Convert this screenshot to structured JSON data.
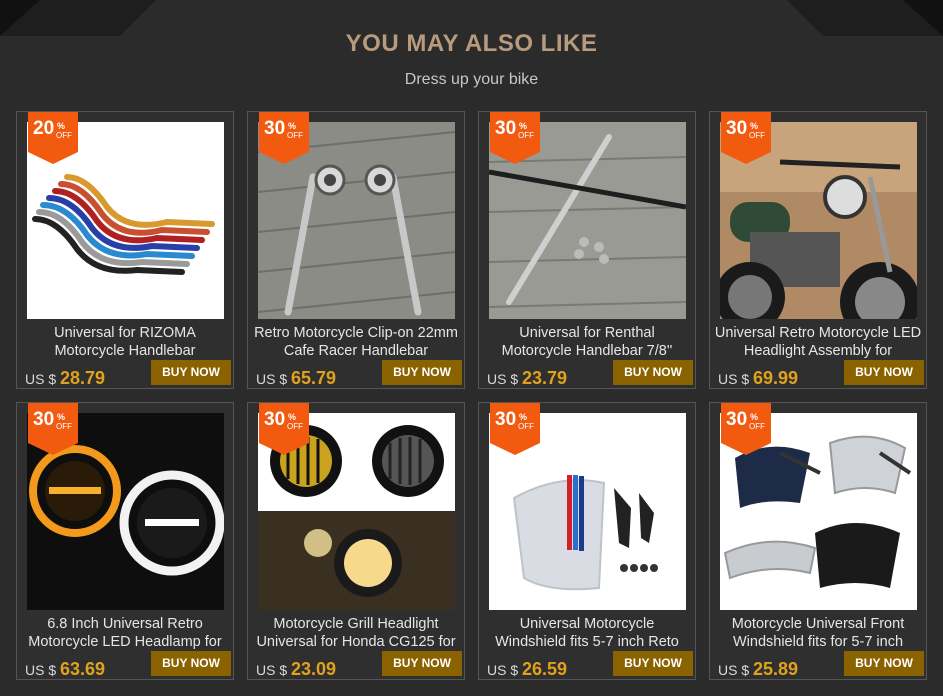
{
  "section": {
    "heading": "YOU MAY ALSO LIKE",
    "subheading": "Dress up your bike"
  },
  "colors": {
    "badge": "#f25a0f",
    "price": "#e0a11c",
    "button": "#8a6200",
    "heading": "#b89b7c"
  },
  "products": [
    {
      "discount": "20",
      "pct": "%",
      "off": "OFF",
      "title": "Universal for RIZOMA Motorcycle Handlebar",
      "currency": "US $",
      "price": "28.79",
      "button": "BUY NOW",
      "image": "handlebars-set"
    },
    {
      "discount": "30",
      "pct": "%",
      "off": "OFF",
      "title": "Retro Motorcycle Clip-on 22mm Cafe Racer Handlebar",
      "currency": "US $",
      "price": "65.79",
      "button": "BUY NOW",
      "image": "clip-on-handlebar"
    },
    {
      "discount": "30",
      "pct": "%",
      "off": "OFF",
      "title": "Universal for Renthal Motorcycle Handlebar 7/8''",
      "currency": "US $",
      "price": "23.79",
      "button": "BUY NOW",
      "image": "straight-handlebar"
    },
    {
      "discount": "30",
      "pct": "%",
      "off": "OFF",
      "title": "Universal Retro Motorcycle LED Headlight Assembly for",
      "currency": "US $",
      "price": "69.99",
      "button": "BUY NOW",
      "image": "motorcycle-photo"
    },
    {
      "discount": "30",
      "pct": "%",
      "off": "OFF",
      "title": "6.8 Inch Universal Retro Motorcycle LED Headlamp for",
      "currency": "US $",
      "price": "63.69",
      "button": "BUY NOW",
      "image": "led-headlamps"
    },
    {
      "discount": "30",
      "pct": "%",
      "off": "OFF",
      "title": "Motorcycle Grill Headlight Universal for Honda CG125 for",
      "currency": "US $",
      "price": "23.09",
      "button": "BUY NOW",
      "image": "grill-headlights"
    },
    {
      "discount": "30",
      "pct": "%",
      "off": "OFF",
      "title": "Universal Motorcycle Windshield fits 5-7 inch Reto",
      "currency": "US $",
      "price": "26.59",
      "button": "BUY NOW",
      "image": "windshield-stripes"
    },
    {
      "discount": "30",
      "pct": "%",
      "off": "OFF",
      "title": "Motorcycle Universal Front Windshield fits for 5-7 inch",
      "currency": "US $",
      "price": "25.89",
      "button": "BUY NOW",
      "image": "windshields-set"
    }
  ]
}
